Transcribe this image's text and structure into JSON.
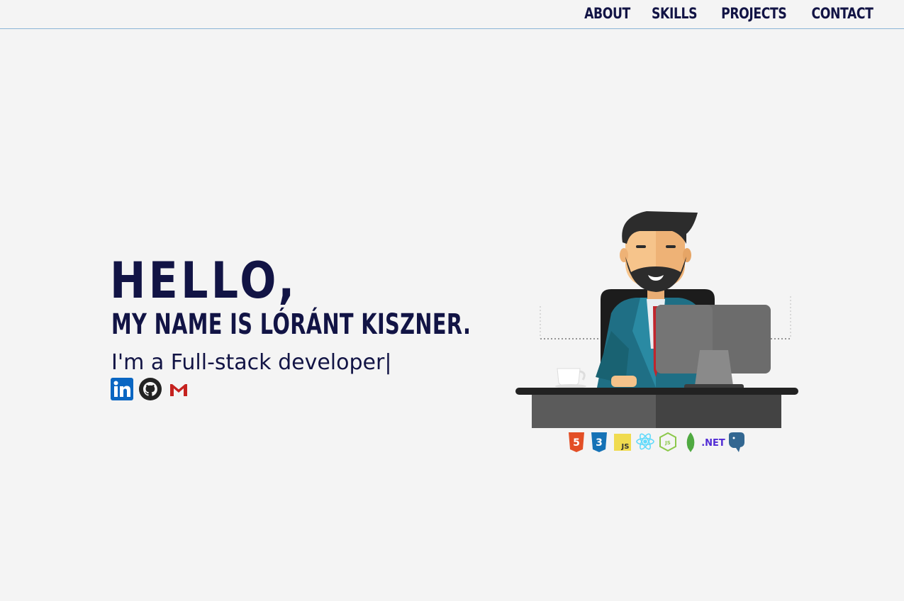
{
  "nav": {
    "items": [
      {
        "label": "About"
      },
      {
        "label": "Skills"
      },
      {
        "label": "Projects"
      },
      {
        "label": "Contact"
      }
    ]
  },
  "hero": {
    "greeting": "Hello,",
    "name_line": "My name is Lóránt Kiszner.",
    "role_line": "I'm a Full-stack developer|"
  },
  "socials": [
    {
      "icon": "linkedin-icon",
      "color": "#0a66c2"
    },
    {
      "icon": "github-icon",
      "color": "#222222"
    },
    {
      "icon": "gmail-icon",
      "color": "#c5221f"
    }
  ],
  "tech_stack": {
    "icons": [
      "html5-icon",
      "css3-icon",
      "javascript-icon",
      "react-icon",
      "nodejs-icon",
      "mongodb-icon",
      "dotnet-icon",
      "postgresql-icon"
    ],
    "dotnet_label": ".NET",
    "js_label": "JS",
    "html_label": "5",
    "css_label": "3"
  },
  "colors": {
    "primary_text": "#121445",
    "background": "#f4f4f4",
    "nav_border": "#8ab4d6"
  }
}
